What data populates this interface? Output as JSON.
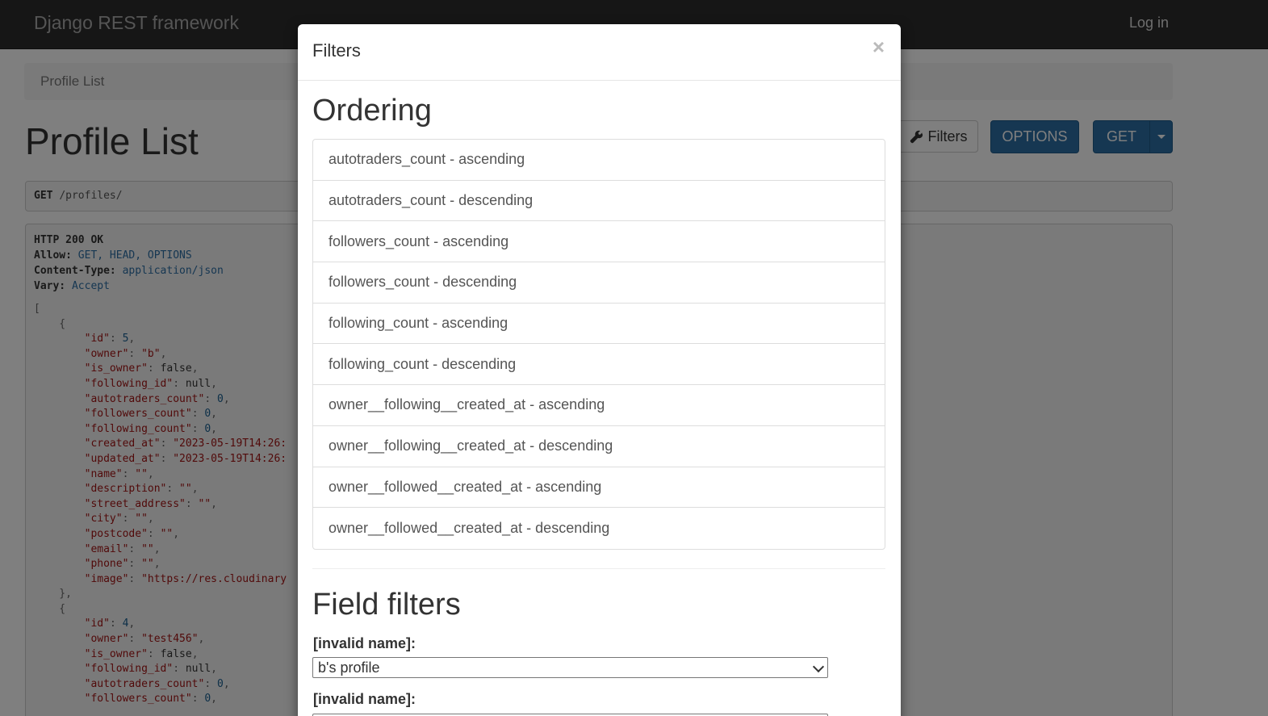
{
  "navbar": {
    "brand": "Django REST framework",
    "login": "Log in"
  },
  "breadcrumb": {
    "current": "Profile List"
  },
  "page": {
    "title": "Profile List"
  },
  "toolbar": {
    "filters_label": "Filters",
    "filters_icon": "wrench-icon",
    "options_label": "OPTIONS",
    "get_label": "GET"
  },
  "request": {
    "method": "GET",
    "path": "/profiles/"
  },
  "response": {
    "status": "HTTP 200 OK",
    "allow_key": "Allow:",
    "allow_val": "GET, HEAD, OPTIONS",
    "ctype_key": "Content-Type:",
    "ctype_val": "application/json",
    "vary_key": "Vary:",
    "vary_val": "Accept"
  },
  "json_lines": [
    [
      "p",
      "["
    ],
    [
      "p",
      "    {"
    ],
    [
      "kv",
      "id",
      "5",
      "n",
      ","
    ],
    [
      "kv",
      "owner",
      "\"b\"",
      "s",
      ","
    ],
    [
      "kv",
      "is_owner",
      "false",
      "lit",
      ","
    ],
    [
      "kv",
      "following_id",
      "null",
      "lit",
      ","
    ],
    [
      "kv",
      "autotraders_count",
      "0",
      "n",
      ","
    ],
    [
      "kv",
      "followers_count",
      "0",
      "n",
      ","
    ],
    [
      "kv",
      "following_count",
      "0",
      "n",
      ","
    ],
    [
      "kv",
      "created_at",
      "\"2023-05-19T14:26:",
      "s",
      ""
    ],
    [
      "kv",
      "updated_at",
      "\"2023-05-19T14:26:",
      "s",
      ""
    ],
    [
      "kv",
      "name",
      "\"\"",
      "s",
      ","
    ],
    [
      "kv",
      "description",
      "\"\"",
      "s",
      ","
    ],
    [
      "kv",
      "street_address",
      "\"\"",
      "s",
      ","
    ],
    [
      "kv",
      "city",
      "\"\"",
      "s",
      ","
    ],
    [
      "kv",
      "postcode",
      "\"\"",
      "s",
      ","
    ],
    [
      "kv",
      "email",
      "\"\"",
      "s",
      ","
    ],
    [
      "kv",
      "phone",
      "\"\"",
      "s",
      ","
    ],
    [
      "kv",
      "image",
      "\"https://res.cloudinary",
      "s",
      ""
    ],
    [
      "p",
      "    },"
    ],
    [
      "p",
      "    {"
    ],
    [
      "kv",
      "id",
      "4",
      "n",
      ","
    ],
    [
      "kv",
      "owner",
      "\"test456\"",
      "s",
      ","
    ],
    [
      "kv",
      "is_owner",
      "false",
      "lit",
      ","
    ],
    [
      "kv",
      "following_id",
      "null",
      "lit",
      ","
    ],
    [
      "kv",
      "autotraders_count",
      "0",
      "n",
      ","
    ],
    [
      "kv",
      "followers_count",
      "0",
      "n",
      ","
    ]
  ],
  "modal": {
    "title": "Filters",
    "close": "×",
    "ordering_title": "Ordering",
    "ordering_items": [
      "autotraders_count - ascending",
      "autotraders_count - descending",
      "followers_count - ascending",
      "followers_count - descending",
      "following_count - ascending",
      "following_count - descending",
      "owner__following__created_at - ascending",
      "owner__following__created_at - descending",
      "owner__followed__created_at - ascending",
      "owner__followed__created_at - descending"
    ],
    "field_filters_title": "Field filters",
    "fields": [
      {
        "label": "[invalid name]:",
        "value": "b's profile"
      },
      {
        "label": "[invalid name]:",
        "value": ""
      }
    ]
  }
}
